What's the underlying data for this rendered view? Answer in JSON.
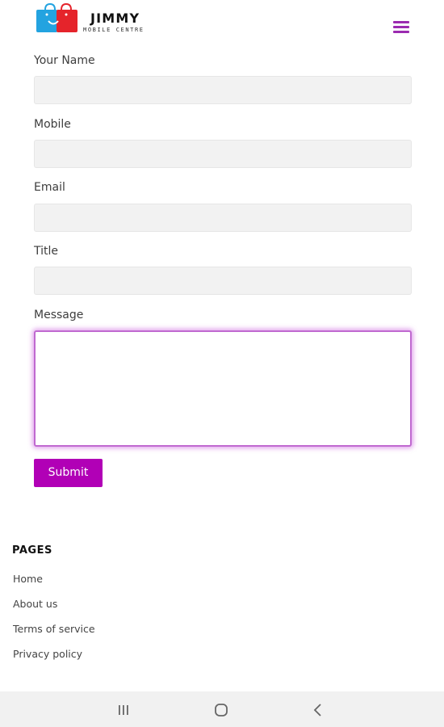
{
  "header": {
    "brand_name": "JIMMY",
    "brand_subtitle": "MOBILE CENTRE",
    "logo_colors": {
      "blue": "#23a3e0",
      "red": "#e5242b"
    },
    "menu_icon": "hamburger-menu-icon",
    "accent": "#9b2bb0"
  },
  "form": {
    "fields": [
      {
        "label": "Your Name",
        "value": "",
        "placeholder": ""
      },
      {
        "label": "Mobile",
        "value": "",
        "placeholder": ""
      },
      {
        "label": "Email",
        "value": "",
        "placeholder": ""
      },
      {
        "label": "Title",
        "value": "",
        "placeholder": ""
      }
    ],
    "message": {
      "label": "Message",
      "value": "",
      "placeholder": ""
    },
    "submit_label": "Submit",
    "submit_color": "#b100b6"
  },
  "footer": {
    "pages_title": "PAGES",
    "links": [
      "Home",
      "About us",
      "Terms of service",
      "Privacy policy"
    ]
  },
  "system_nav": {
    "buttons": [
      "recent-apps-icon",
      "home-icon",
      "back-icon"
    ]
  }
}
